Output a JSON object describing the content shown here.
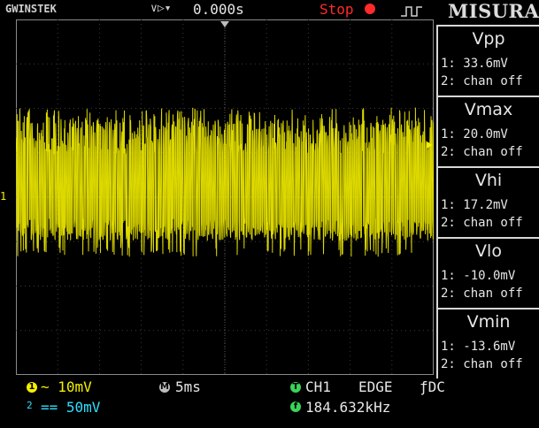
{
  "topbar": {
    "brand": "GWINSTEK",
    "trigger_icons": "∨▷▾",
    "horizontal_position": "0.000s",
    "run_state": "Stop",
    "watermark": "MISURA"
  },
  "colors": {
    "ch1": "#f4f000",
    "ch2": "#2ee0ff",
    "stop": "#ff2a2a",
    "trigger_badge": "#39d45a",
    "grid": "#3a3a3a"
  },
  "icons": {
    "stop_indicator": "stop-dot-icon",
    "trigger_edge": "rising-edge-icon"
  },
  "channel_marker": "1",
  "measurements": [
    {
      "title": "Vpp",
      "ch1": "1: 33.6mV",
      "ch2": "2: chan off"
    },
    {
      "title": "Vmax",
      "ch1": "1: 20.0mV",
      "ch2": "2: chan off"
    },
    {
      "title": "Vhi",
      "ch1": "1: 17.2mV",
      "ch2": "2: chan off"
    },
    {
      "title": "Vlo",
      "ch1": "1: -10.0mV",
      "ch2": "2: chan off"
    },
    {
      "title": "Vmin",
      "ch1": "1: -13.6mV",
      "ch2": "2: chan off"
    }
  ],
  "status": {
    "ch1_badge": "1",
    "ch1_scale": "~ 10mV",
    "ch2_badge": "2",
    "ch2_scale": "== 50mV",
    "timebase_badge": "M",
    "timebase": "5ms",
    "trigger_badge": "T",
    "trigger_source": "CH1",
    "trigger_type": "EDGE",
    "trigger_coupling": "ƒDC",
    "freq_badge": "f",
    "frequency": "184.632kHz"
  },
  "waveform": {
    "channel": "CH1",
    "vmax_mv": 20.0,
    "vmin_mv": -13.6,
    "vhi_mv": 17.2,
    "vlo_mv": -10.0,
    "volts_per_div_mv": 10
  }
}
